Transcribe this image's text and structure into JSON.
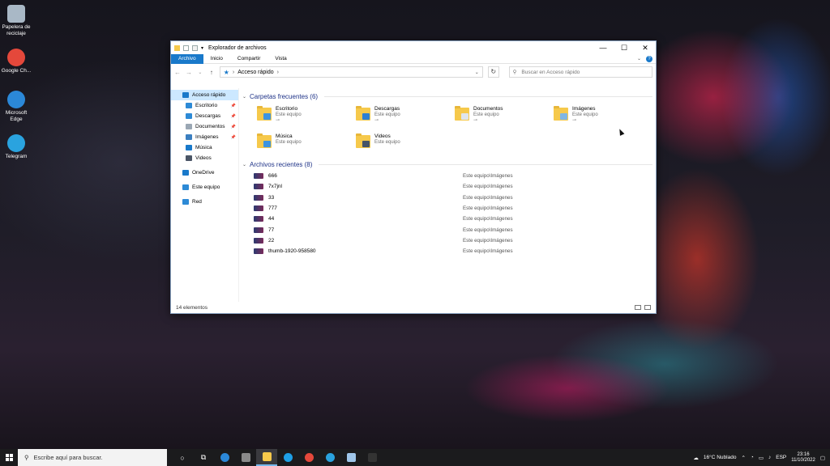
{
  "desktop": {
    "icons": [
      {
        "label": "Papelera de reciclaje",
        "icon": "recycle-bin-icon",
        "color": "#a9b8c6"
      },
      {
        "label": "Google Ch...",
        "icon": "chrome-icon",
        "color": "#e4483b"
      },
      {
        "label": "Microsoft Edge",
        "icon": "edge-icon",
        "color": "#2b88d8"
      },
      {
        "label": "Telegram",
        "icon": "telegram-icon",
        "color": "#2aa3df"
      }
    ]
  },
  "window": {
    "title": "Explorador de archivos",
    "ribbon_tabs": [
      "Archivo",
      "Inicio",
      "Compartir",
      "Vista"
    ],
    "help": "?",
    "address": "Acceso rápido",
    "search_placeholder": "Buscar en Acceso rápido",
    "status_count": "14 elementos"
  },
  "sidebar": {
    "items": [
      {
        "label": "Acceso rápido",
        "icon": "star-icon",
        "color": "#1979ca",
        "selected": true,
        "pinned": false
      },
      {
        "label": "Escritorio",
        "icon": "desktop-icon",
        "color": "#2d8ad6",
        "pinned": true
      },
      {
        "label": "Descargas",
        "icon": "download-icon",
        "color": "#2d8ad6",
        "pinned": true
      },
      {
        "label": "Documentos",
        "icon": "document-icon",
        "color": "#9aa7b4",
        "pinned": true
      },
      {
        "label": "Imágenes",
        "icon": "image-icon",
        "color": "#3b7fc0",
        "pinned": true
      },
      {
        "label": "Música",
        "icon": "music-icon",
        "color": "#1979ca",
        "pinned": false
      },
      {
        "label": "Videos",
        "icon": "video-icon",
        "color": "#4a5566",
        "pinned": false
      },
      {
        "label": "OneDrive",
        "icon": "onedrive-icon",
        "color": "#1979ca"
      },
      {
        "label": "Este equipo",
        "icon": "computer-icon",
        "color": "#2d8ad6"
      },
      {
        "label": "Red",
        "icon": "network-icon",
        "color": "#2d8ad6"
      }
    ]
  },
  "frequent": {
    "header": "Carpetas frecuentes (6)",
    "items": [
      {
        "name": "Escritorio",
        "location": "Este equipo",
        "pinned": true,
        "badge": "#3d94e0"
      },
      {
        "name": "Descargas",
        "location": "Este equipo",
        "pinned": true,
        "badge": "#2d7fd3"
      },
      {
        "name": "Documentos",
        "location": "Este equipo",
        "pinned": true,
        "badge": "#dfe5ec"
      },
      {
        "name": "Imágenes",
        "location": "Este equipo",
        "pinned": true,
        "badge": "#7fb6e4"
      },
      {
        "name": "Música",
        "location": "Este equipo",
        "pinned": false,
        "badge": "#3d94e0"
      },
      {
        "name": "Videos",
        "location": "Este equipo",
        "pinned": false,
        "badge": "#455468"
      }
    ]
  },
  "recent": {
    "header": "Archivos recientes (8)",
    "items": [
      {
        "name": "666",
        "path": "Este equipo\\Imágenes"
      },
      {
        "name": "7x7jnl",
        "path": "Este equipo\\Imágenes"
      },
      {
        "name": "33",
        "path": "Este equipo\\Imágenes"
      },
      {
        "name": "777",
        "path": "Este equipo\\Imágenes"
      },
      {
        "name": "44",
        "path": "Este equipo\\Imágenes"
      },
      {
        "name": "77",
        "path": "Este equipo\\Imágenes"
      },
      {
        "name": "22",
        "path": "Este equipo\\Imágenes"
      },
      {
        "name": "thumb-1920-958580",
        "path": "Este equipo\\Imágenes"
      }
    ]
  },
  "taskbar": {
    "search_placeholder": "Escribe aquí para buscar.",
    "apps": [
      {
        "icon": "cortana-icon",
        "glyph": "○",
        "color": "#ffffff"
      },
      {
        "icon": "task-view-icon",
        "glyph": "⧉",
        "color": "#ffffff"
      },
      {
        "icon": "edge-icon",
        "glyph": "",
        "color": "#2b88d8"
      },
      {
        "icon": "calculator-icon",
        "glyph": "",
        "color": "#8a8a8a"
      },
      {
        "icon": "file-explorer-icon",
        "glyph": "",
        "color": "#f6c94b",
        "active": true
      },
      {
        "icon": "skype-icon",
        "glyph": "",
        "color": "#1ea0e6"
      },
      {
        "icon": "chrome-icon",
        "glyph": "",
        "color": "#e4483b"
      },
      {
        "icon": "telegram-icon",
        "glyph": "",
        "color": "#2aa3df"
      },
      {
        "icon": "notepad-icon",
        "glyph": "",
        "color": "#9fc6ea"
      },
      {
        "icon": "terminal-icon",
        "glyph": "",
        "color": "#333333"
      }
    ],
    "weather": "16°C Nublado",
    "language": "ESP",
    "time": "23:16",
    "date": "11/10/2022"
  }
}
